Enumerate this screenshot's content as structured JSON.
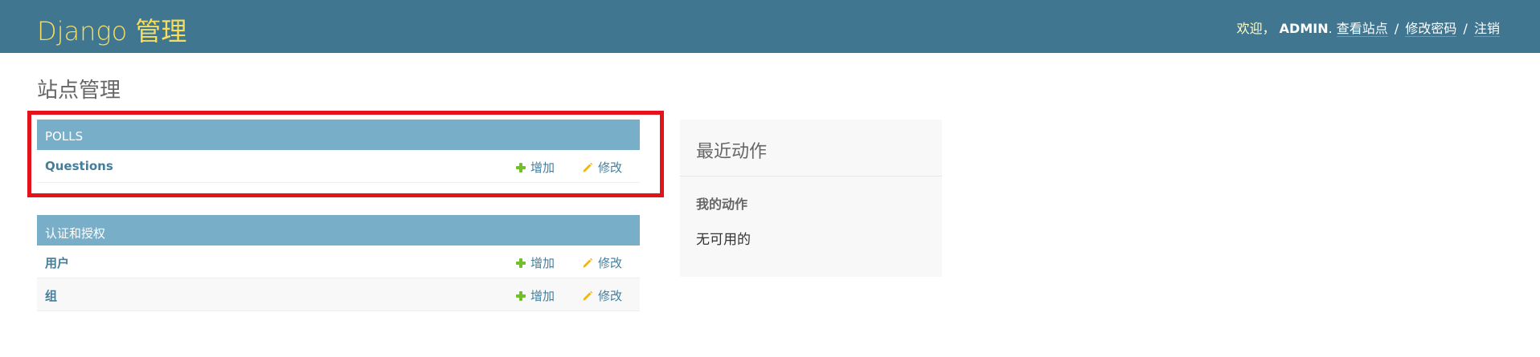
{
  "header": {
    "brand": "Django 管理",
    "welcome": "欢迎，",
    "username": "ADMIN",
    "dot": ".",
    "view_site": "查看站点",
    "change_password": "修改密码",
    "logout": "注销",
    "separator": "/",
    "colors": {
      "bar": "#417690",
      "brand": "#f5dd5d"
    }
  },
  "page_title": "站点管理",
  "modules": [
    {
      "caption": "POLLS",
      "rows": [
        {
          "name": "Questions",
          "add": "增加",
          "change": "修改"
        }
      ]
    },
    {
      "caption": "认证和授权",
      "rows": [
        {
          "name": "用户",
          "add": "增加",
          "change": "修改"
        },
        {
          "name": "组",
          "add": "增加",
          "change": "修改"
        }
      ]
    }
  ],
  "recent_actions": {
    "title": "最近动作",
    "my_actions": "我的动作",
    "empty": "无可用的"
  },
  "icons": {
    "add": "plus-icon",
    "change": "pencil-icon"
  }
}
